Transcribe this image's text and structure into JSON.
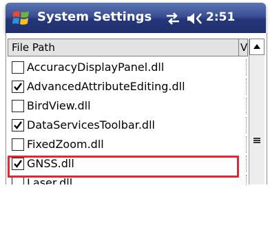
{
  "status_bar": {
    "app_title": "System Settings",
    "time": "2:51",
    "icons": [
      "windows-start-icon",
      "connectivity-icon",
      "volume-icon"
    ]
  },
  "table": {
    "columns": [
      "File Path",
      "V"
    ],
    "rows": [
      {
        "label": "AccuracyDisplayPanel.dll",
        "checked": false
      },
      {
        "label": "AdvancedAttributeEditing.dll",
        "checked": true
      },
      {
        "label": "BirdView.dll",
        "checked": false
      },
      {
        "label": "DataServicesToolbar.dll",
        "checked": true
      },
      {
        "label": "FixedZoom.dll",
        "checked": false
      },
      {
        "label": "GNSS.dll",
        "checked": true
      },
      {
        "label": "Laser.dll",
        "checked": false
      }
    ],
    "highlighted_row": "GNSS.dll"
  },
  "colors": {
    "titlebar": "#24367a",
    "highlight": "#e02834"
  }
}
